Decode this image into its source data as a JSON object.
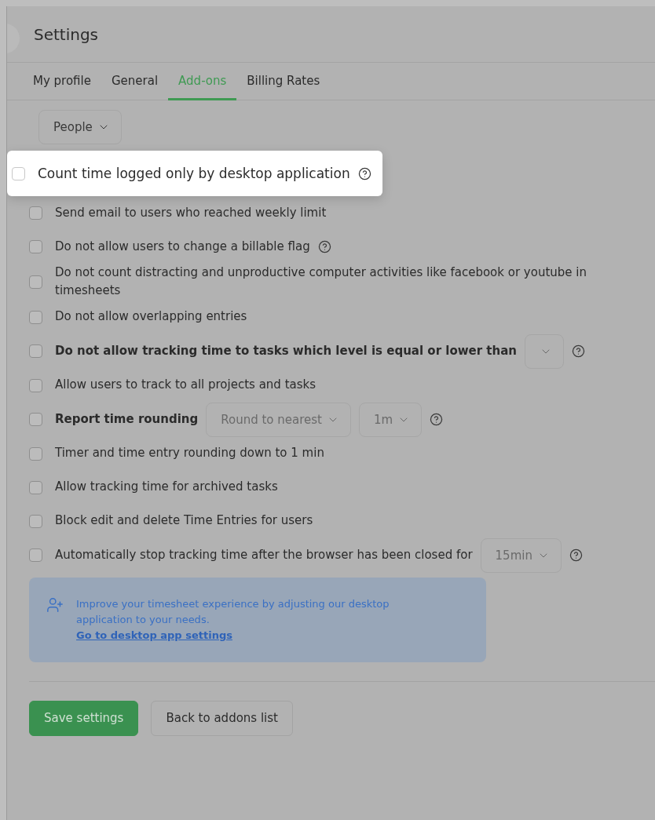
{
  "header": {
    "title": "Settings"
  },
  "tabs": [
    {
      "label": "My profile",
      "selected": false
    },
    {
      "label": "General",
      "selected": false
    },
    {
      "label": "Add-ons",
      "selected": true
    },
    {
      "label": "Billing Rates",
      "selected": false
    }
  ],
  "filter": {
    "value": "People"
  },
  "options": [
    {
      "label": "Count time logged only by desktop application",
      "checked": false,
      "highlighted": true,
      "bold": false,
      "controls": [
        {
          "kind": "help"
        }
      ]
    },
    {
      "label": "Send email to users who reached weekly limit",
      "checked": false,
      "highlighted": false,
      "bold": false
    },
    {
      "label": "Do not allow users to change a billable flag",
      "checked": false,
      "highlighted": false,
      "bold": false,
      "controls": [
        {
          "kind": "help"
        }
      ]
    },
    {
      "label": "Do not count distracting and unproductive computer activities like facebook or youtube in timesheets",
      "checked": false,
      "highlighted": false,
      "bold": false
    },
    {
      "label": "Do not allow overlapping entries",
      "checked": false,
      "highlighted": false,
      "bold": false
    },
    {
      "label": "Do not allow tracking time to tasks which level is equal or lower than",
      "checked": false,
      "highlighted": false,
      "bold": true,
      "controls": [
        {
          "kind": "select"
        },
        {
          "kind": "help"
        }
      ]
    },
    {
      "label": "Allow users to track to all projects and tasks",
      "checked": false,
      "highlighted": false,
      "bold": false
    },
    {
      "label": "Report time rounding",
      "checked": false,
      "highlighted": false,
      "bold": true,
      "controls": [
        {
          "kind": "select",
          "value": "Round to nearest"
        },
        {
          "kind": "select",
          "value": "1m"
        },
        {
          "kind": "help"
        }
      ]
    },
    {
      "label": "Timer and time entry rounding down to 1 min",
      "checked": false,
      "highlighted": false,
      "bold": false
    },
    {
      "label": "Allow tracking time for archived tasks",
      "checked": false,
      "highlighted": false,
      "bold": false
    },
    {
      "label": "Block edit and delete Time Entries for users",
      "checked": false,
      "highlighted": false,
      "bold": false
    },
    {
      "label": "Automatically stop tracking time after the browser has been closed for",
      "checked": false,
      "highlighted": false,
      "bold": false,
      "controls": [
        {
          "kind": "select",
          "value": "15min"
        },
        {
          "kind": "help"
        }
      ]
    }
  ],
  "notice": {
    "text": "Improve your timesheet experience by adjusting our desktop application to your needs.",
    "link": "Go to desktop app settings"
  },
  "buttons": [
    {
      "label": "Save settings",
      "kind": "primary"
    },
    {
      "label": "Back to addons list",
      "kind": "secondary"
    }
  ]
}
